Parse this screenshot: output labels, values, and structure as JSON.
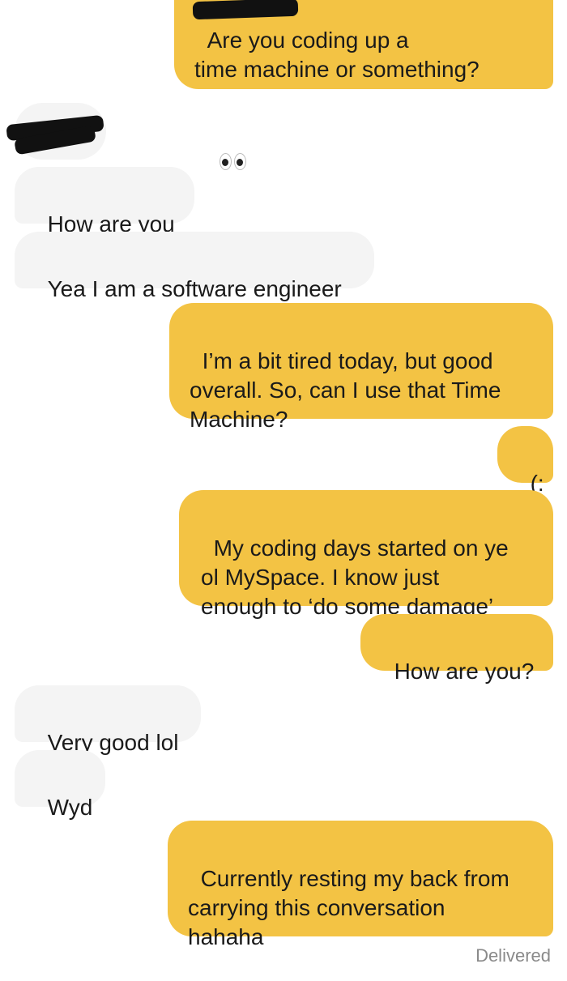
{
  "conversation": {
    "messages": [
      {
        "from": "me",
        "text": "Are you coding up a\ntime machine or something?",
        "emoji": "eyes-emoji"
      },
      {
        "from": "them",
        "text": "How are you"
      },
      {
        "from": "them",
        "text": "Yea I am a software engineer"
      },
      {
        "from": "me",
        "text": "I’m a bit tired today, but good\noverall. So, can I use that Time\nMachine?"
      },
      {
        "from": "me",
        "text": "(:"
      },
      {
        "from": "me",
        "text": "My coding days started on ye\nol MySpace. I know just\nenough to ‘do some damage’"
      },
      {
        "from": "me",
        "text": "How are you?"
      },
      {
        "from": "them",
        "text": "Very good lol"
      },
      {
        "from": "them",
        "text": "Wyd"
      },
      {
        "from": "me",
        "text": "Currently resting my back from\ncarrying this conversation\nhahaha"
      }
    ],
    "status": "Delivered"
  },
  "colors": {
    "sent_bubble": "#f3c344",
    "received_bubble": "#f4f4f4",
    "text": "#1a1a1a",
    "status_text": "#8a8a8a"
  }
}
